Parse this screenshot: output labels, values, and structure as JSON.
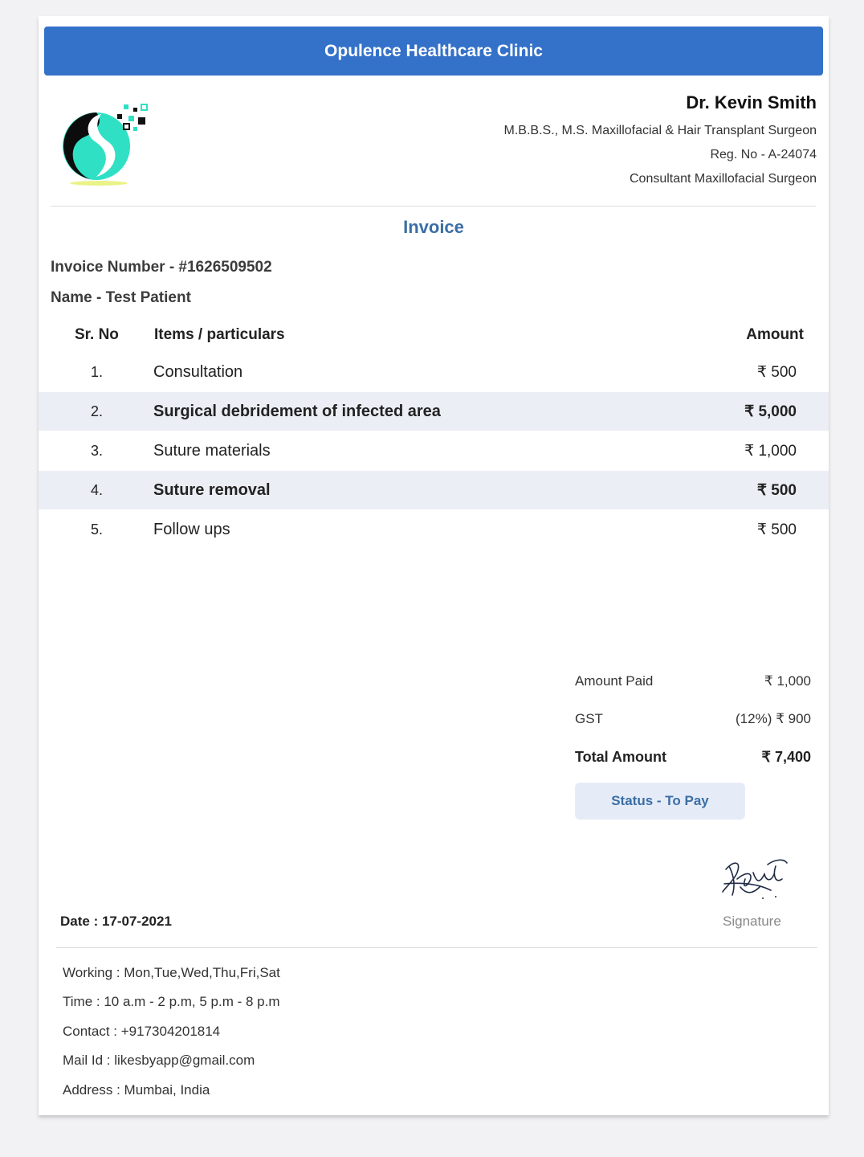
{
  "banner": {
    "title": "Opulence Healthcare Clinic"
  },
  "doctor": {
    "name": "Dr. Kevin Smith",
    "qualification": "M.B.B.S., M.S. Maxillofacial & Hair Transplant Surgeon",
    "registration": "Reg. No - A-24074",
    "designation": "Consultant Maxillofacial Surgeon"
  },
  "invoice": {
    "title": "Invoice",
    "number": "Invoice Number - #1626509502",
    "name": "Name - Test Patient"
  },
  "table": {
    "headers": {
      "sr": "Sr. No",
      "item": "Items / particulars",
      "amount": "Amount"
    },
    "rows": [
      {
        "sr": "1.",
        "item": "Consultation",
        "amount": "₹  500"
      },
      {
        "sr": "2.",
        "item": "Surgical debridement of infected area",
        "amount": "₹  5,000"
      },
      {
        "sr": "3.",
        "item": "Suture materials",
        "amount": "₹  1,000"
      },
      {
        "sr": "4.",
        "item": "Suture removal",
        "amount": "₹  500"
      },
      {
        "sr": "5.",
        "item": "Follow ups",
        "amount": "₹  500"
      }
    ]
  },
  "summary": {
    "paid_label": "Amount Paid",
    "paid_value": "₹ 1,000",
    "gst_label": "GST",
    "gst_value": "(12%) ₹ 900",
    "total_label": "Total Amount",
    "total_value": "₹ 7,400",
    "status": "Status - To Pay"
  },
  "signature": {
    "label": "Signature"
  },
  "date": "Date : 17-07-2021",
  "footer": {
    "working": "Working : Mon,Tue,Wed,Thu,Fri,Sat",
    "time": "Time : 10 a.m - 2 p.m, 5 p.m - 8 p.m",
    "contact": "Contact : +917304201814",
    "mail": "Mail Id : likesbyapp@gmail.com",
    "address": "Address : Mumbai, India"
  },
  "colors": {
    "banner": "#3471c9",
    "accent": "#3a6ea5",
    "logo_teal": "#2fe0c4",
    "row_alt": "#eceef5"
  }
}
